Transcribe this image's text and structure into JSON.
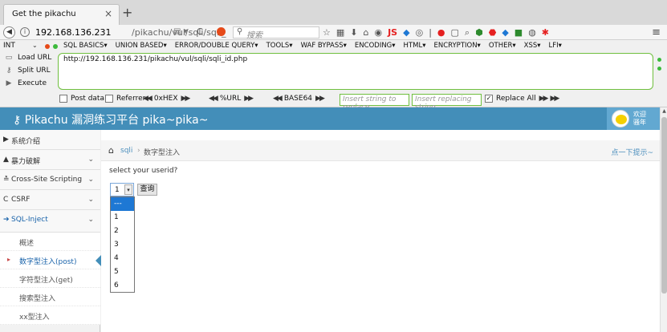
{
  "browser": {
    "tab_title": "Get the pikachu",
    "tab_close": "×",
    "new_tab": "+",
    "url_host": "192.168.136.231",
    "url_path": "/pikachu/vul/sqli/sqli_",
    "search_placeholder": "搜索",
    "toolbar_icons": [
      "star-icon",
      "reader-icon",
      "download-icon",
      "home-icon",
      "addon-icon",
      "js-icon",
      "addon-icon",
      "addon-icon",
      "addon-icon",
      "addon-icon",
      "addon-icon",
      "zoom-icon",
      "shield-icon",
      "abp-icon",
      "addon-icon",
      "addon-icon",
      "addon-icon",
      "addon-icon"
    ],
    "toolbar_js_label": "JS"
  },
  "hackbar": {
    "int_select": "INT",
    "menu": [
      "SQL BASICS",
      "UNION BASED",
      "ERROR/DOUBLE QUERY",
      "TOOLS",
      "WAF BYPASS",
      "ENCODING",
      "HTML",
      "ENCRYPTION",
      "OTHER",
      "XSS",
      "LFI"
    ],
    "actions": {
      "load": "Load URL",
      "split": "Split URL",
      "execute": "Execute"
    },
    "url_value": "http://192.168.136.231/pikachu/vul/sqli/sqli_id.php",
    "options": {
      "post_data": "Post data",
      "referrer": "Referrer",
      "hex": "0xHEX",
      "url": "%URL",
      "base64": "BASE64",
      "replace_placeholder": "Insert string to replace",
      "replacing_placeholder": "Insert replacing string",
      "replace_all": "Replace All",
      "replace_all_checked": "✓"
    },
    "accent_color": "#6fbf3e"
  },
  "site": {
    "title": "Pikachu 漏洞练习平台 pika~pika~",
    "welcome": "欢迎\n骚年",
    "header_color": "#438eb9"
  },
  "sidebar": {
    "items": [
      {
        "label": "系统介绍",
        "icon": "megaphone-icon",
        "glyph": "▶"
      },
      {
        "label": "暴力破解",
        "icon": "lock-icon",
        "glyph": "▲",
        "chev": "⌄"
      },
      {
        "label": "Cross-Site Scripting",
        "icon": "xss-icon",
        "glyph": "≛",
        "chev": "⌄"
      },
      {
        "label": "CSRF",
        "icon": "csrf-icon",
        "glyph": "C",
        "chev": "⌄"
      },
      {
        "label": "SQL-Inject",
        "icon": "sqli-icon",
        "glyph": "➔",
        "chev": "⌄"
      }
    ],
    "sub_items": [
      {
        "label": "概述"
      },
      {
        "label": "数字型注入(post)",
        "marker": "▸"
      },
      {
        "label": "字符型注入(get)"
      },
      {
        "label": "搜索型注入"
      },
      {
        "label": "xx型注入"
      }
    ]
  },
  "main": {
    "breadcrumb": {
      "section": "sqli",
      "sep": "›",
      "current": "数字型注入"
    },
    "hint": "点一下提示~",
    "prompt": "select your userid?",
    "select_value": "1",
    "query_button": "查询",
    "dropdown_options": [
      "---",
      "1",
      "2",
      "3",
      "4",
      "5",
      "6"
    ]
  }
}
